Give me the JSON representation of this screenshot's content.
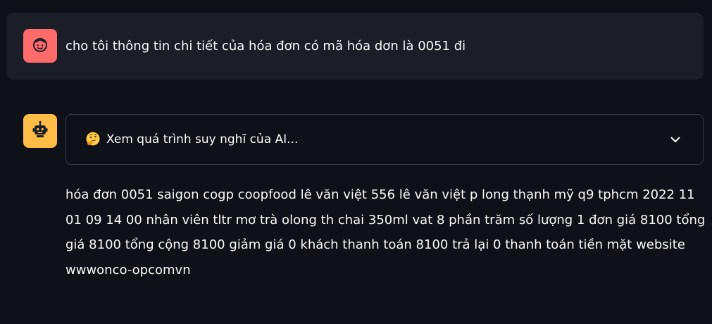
{
  "user_message": {
    "avatar_icon": "user-face-icon",
    "avatar_color": "#ff6b6b",
    "text": "cho tôi thông tin chi tiết của hóa đơn có mã hóa dơn là 0051 đi"
  },
  "assistant_message": {
    "avatar_icon": "robot-icon",
    "avatar_color": "#ffbd45",
    "expander": {
      "emoji_icon": "thinking-face-icon",
      "label": "Xem quá trình suy nghĩ của AI...",
      "chevron_icon": "chevron-down-icon"
    },
    "answer": "hóa đơn 0051 saigon cogp coopfood lê văn việt 556 lê văn việt p long thạnh mỹ q9 tphcm 2022 11 01 09 14 00 nhân viên tltr mơ trà olong th chai 350ml vat 8 phần trăm số lượng 1 đơn giá 8100 tổng giá 8100 tổng cộng 8100 giảm giá 0 khách thanh toán 8100 trả lại 0 thanh toán tiền mặt website wwwonco-opcomvn"
  },
  "colors": {
    "background": "#0e1117",
    "user_bubble": "#1b1e27",
    "expander_border": "#3a3d46",
    "text": "#fafafa"
  }
}
